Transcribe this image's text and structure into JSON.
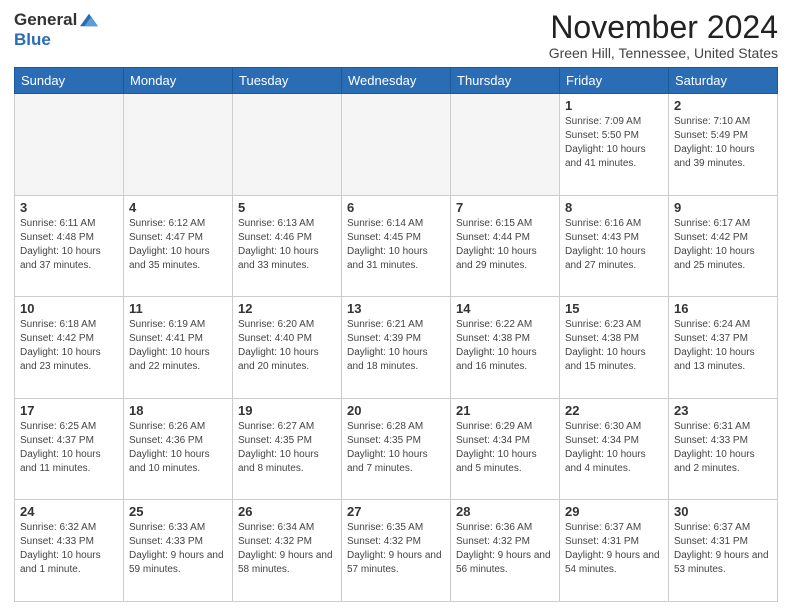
{
  "header": {
    "logo": {
      "general": "General",
      "blue": "Blue"
    },
    "title": "November 2024",
    "location": "Green Hill, Tennessee, United States"
  },
  "days_of_week": [
    "Sunday",
    "Monday",
    "Tuesday",
    "Wednesday",
    "Thursday",
    "Friday",
    "Saturday"
  ],
  "weeks": [
    [
      {
        "day": "",
        "empty": true
      },
      {
        "day": "",
        "empty": true
      },
      {
        "day": "",
        "empty": true
      },
      {
        "day": "",
        "empty": true
      },
      {
        "day": "",
        "empty": true
      },
      {
        "day": "1",
        "sunrise": "7:09 AM",
        "sunset": "5:50 PM",
        "daylight": "10 hours and 41 minutes."
      },
      {
        "day": "2",
        "sunrise": "7:10 AM",
        "sunset": "5:49 PM",
        "daylight": "10 hours and 39 minutes."
      }
    ],
    [
      {
        "day": "3",
        "sunrise": "6:11 AM",
        "sunset": "4:48 PM",
        "daylight": "10 hours and 37 minutes."
      },
      {
        "day": "4",
        "sunrise": "6:12 AM",
        "sunset": "4:47 PM",
        "daylight": "10 hours and 35 minutes."
      },
      {
        "day": "5",
        "sunrise": "6:13 AM",
        "sunset": "4:46 PM",
        "daylight": "10 hours and 33 minutes."
      },
      {
        "day": "6",
        "sunrise": "6:14 AM",
        "sunset": "4:45 PM",
        "daylight": "10 hours and 31 minutes."
      },
      {
        "day": "7",
        "sunrise": "6:15 AM",
        "sunset": "4:44 PM",
        "daylight": "10 hours and 29 minutes."
      },
      {
        "day": "8",
        "sunrise": "6:16 AM",
        "sunset": "4:43 PM",
        "daylight": "10 hours and 27 minutes."
      },
      {
        "day": "9",
        "sunrise": "6:17 AM",
        "sunset": "4:42 PM",
        "daylight": "10 hours and 25 minutes."
      }
    ],
    [
      {
        "day": "10",
        "sunrise": "6:18 AM",
        "sunset": "4:42 PM",
        "daylight": "10 hours and 23 minutes."
      },
      {
        "day": "11",
        "sunrise": "6:19 AM",
        "sunset": "4:41 PM",
        "daylight": "10 hours and 22 minutes."
      },
      {
        "day": "12",
        "sunrise": "6:20 AM",
        "sunset": "4:40 PM",
        "daylight": "10 hours and 20 minutes."
      },
      {
        "day": "13",
        "sunrise": "6:21 AM",
        "sunset": "4:39 PM",
        "daylight": "10 hours and 18 minutes."
      },
      {
        "day": "14",
        "sunrise": "6:22 AM",
        "sunset": "4:38 PM",
        "daylight": "10 hours and 16 minutes."
      },
      {
        "day": "15",
        "sunrise": "6:23 AM",
        "sunset": "4:38 PM",
        "daylight": "10 hours and 15 minutes."
      },
      {
        "day": "16",
        "sunrise": "6:24 AM",
        "sunset": "4:37 PM",
        "daylight": "10 hours and 13 minutes."
      }
    ],
    [
      {
        "day": "17",
        "sunrise": "6:25 AM",
        "sunset": "4:37 PM",
        "daylight": "10 hours and 11 minutes."
      },
      {
        "day": "18",
        "sunrise": "6:26 AM",
        "sunset": "4:36 PM",
        "daylight": "10 hours and 10 minutes."
      },
      {
        "day": "19",
        "sunrise": "6:27 AM",
        "sunset": "4:35 PM",
        "daylight": "10 hours and 8 minutes."
      },
      {
        "day": "20",
        "sunrise": "6:28 AM",
        "sunset": "4:35 PM",
        "daylight": "10 hours and 7 minutes."
      },
      {
        "day": "21",
        "sunrise": "6:29 AM",
        "sunset": "4:34 PM",
        "daylight": "10 hours and 5 minutes."
      },
      {
        "day": "22",
        "sunrise": "6:30 AM",
        "sunset": "4:34 PM",
        "daylight": "10 hours and 4 minutes."
      },
      {
        "day": "23",
        "sunrise": "6:31 AM",
        "sunset": "4:33 PM",
        "daylight": "10 hours and 2 minutes."
      }
    ],
    [
      {
        "day": "24",
        "sunrise": "6:32 AM",
        "sunset": "4:33 PM",
        "daylight": "10 hours and 1 minute."
      },
      {
        "day": "25",
        "sunrise": "6:33 AM",
        "sunset": "4:33 PM",
        "daylight": "9 hours and 59 minutes."
      },
      {
        "day": "26",
        "sunrise": "6:34 AM",
        "sunset": "4:32 PM",
        "daylight": "9 hours and 58 minutes."
      },
      {
        "day": "27",
        "sunrise": "6:35 AM",
        "sunset": "4:32 PM",
        "daylight": "9 hours and 57 minutes."
      },
      {
        "day": "28",
        "sunrise": "6:36 AM",
        "sunset": "4:32 PM",
        "daylight": "9 hours and 56 minutes."
      },
      {
        "day": "29",
        "sunrise": "6:37 AM",
        "sunset": "4:31 PM",
        "daylight": "9 hours and 54 minutes."
      },
      {
        "day": "30",
        "sunrise": "6:37 AM",
        "sunset": "4:31 PM",
        "daylight": "9 hours and 53 minutes."
      }
    ]
  ]
}
